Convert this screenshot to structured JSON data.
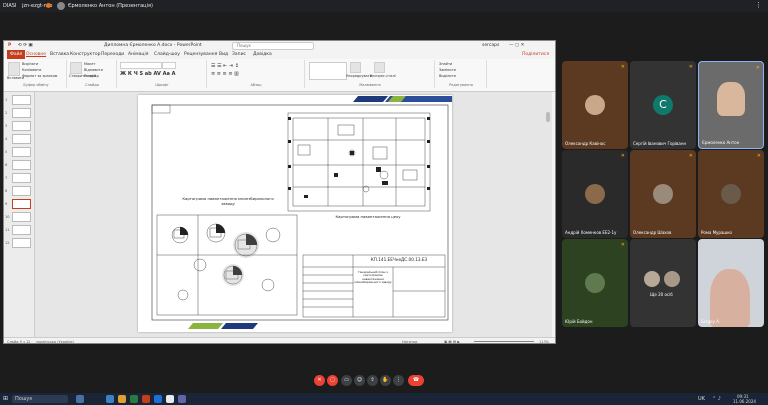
{
  "meet_bar": {
    "title": "DIASI",
    "code": "jzn-ezgt-nzo",
    "presenter": "Єрмоленко Антон (Презентація)"
  },
  "ppt": {
    "title": "Дипломна Єрмоленко А.docx - PowerPoint",
    "search_placeholder": "Пошук",
    "user": "sercaps",
    "share_label": "Поділитися",
    "tabs": [
      "Файл",
      "Основне",
      "Вставка",
      "Конструктор",
      "Переходи",
      "Анімація",
      "Слайд-шоу",
      "Рецензування",
      "Вид",
      "Запис",
      "Довідка"
    ],
    "ribbon": {
      "clipboard": {
        "group": "Буфер обміну",
        "paste": "Вставити",
        "cut": "Вирізати",
        "copy": "Копіювати",
        "format": "Формат за зразком"
      },
      "slides": {
        "group": "Слайди",
        "new": "Створити слайд",
        "layout": "Макет",
        "reset": "Відновити",
        "section": "Розділ"
      },
      "font": {
        "group": "Шрифт"
      },
      "paragraph": {
        "group": "Абзац"
      },
      "drawing": {
        "group": "Малювання",
        "arrange": "Упорядкувати",
        "styles": "Експрес-стилі"
      },
      "editing": {
        "group": "Редагування",
        "find": "Знайти",
        "replace": "Замінити",
        "select": "Виділити"
      }
    },
    "thumb_numbers": [
      "1",
      "2",
      "3",
      "4",
      "5",
      "6",
      "7",
      "8",
      "9",
      "10",
      "11",
      "12"
    ],
    "selected_slide": 9,
    "status": {
      "slide": "Слайд 9 з 12",
      "lang": "українська (Україна)",
      "notes": "Нотатки",
      "zoom": "113%"
    }
  },
  "slide": {
    "caption_factory": "Картограма навантаження млинзбирального заводу",
    "caption_shop": "Картограма навантаження цеху",
    "stamp_code": "КП.141.ЕЕЧнеДС.00.13.Е3",
    "stamp_title": "Генеральний план з картограмою навантаження млинзбирального заводу"
  },
  "participants": [
    {
      "name": "Олександр Кавінос",
      "avatar": "photo",
      "mic": "muted"
    },
    {
      "name": "Сергій Іванович Горіванн",
      "avatar": "letter",
      "letter": "C",
      "color": "#0f7a6c",
      "mic": "muted"
    },
    {
      "name": "Єрмоленко Антон",
      "avatar": "photo",
      "mic": "muted"
    },
    {
      "name": "Андрій Хоменков ЕЕ2-1у",
      "avatar": "photo",
      "mic": "muted"
    },
    {
      "name": "Олександр Шахов",
      "avatar": "photo",
      "mic": "muted"
    },
    {
      "name": "Рома Мурашко",
      "avatar": "photo",
      "mic": "muted"
    },
    {
      "name": "Юрій Бойдон",
      "avatar": "photo",
      "mic": "muted"
    },
    {
      "name": "Ще 20 осіб",
      "avatar": "group",
      "mic": ""
    },
    {
      "name": "Sergey A.",
      "avatar": "video",
      "mic": ""
    }
  ],
  "taskbar": {
    "search": "Пошук",
    "lang": "UK",
    "time": "09:31",
    "date": "11.06.2024"
  }
}
